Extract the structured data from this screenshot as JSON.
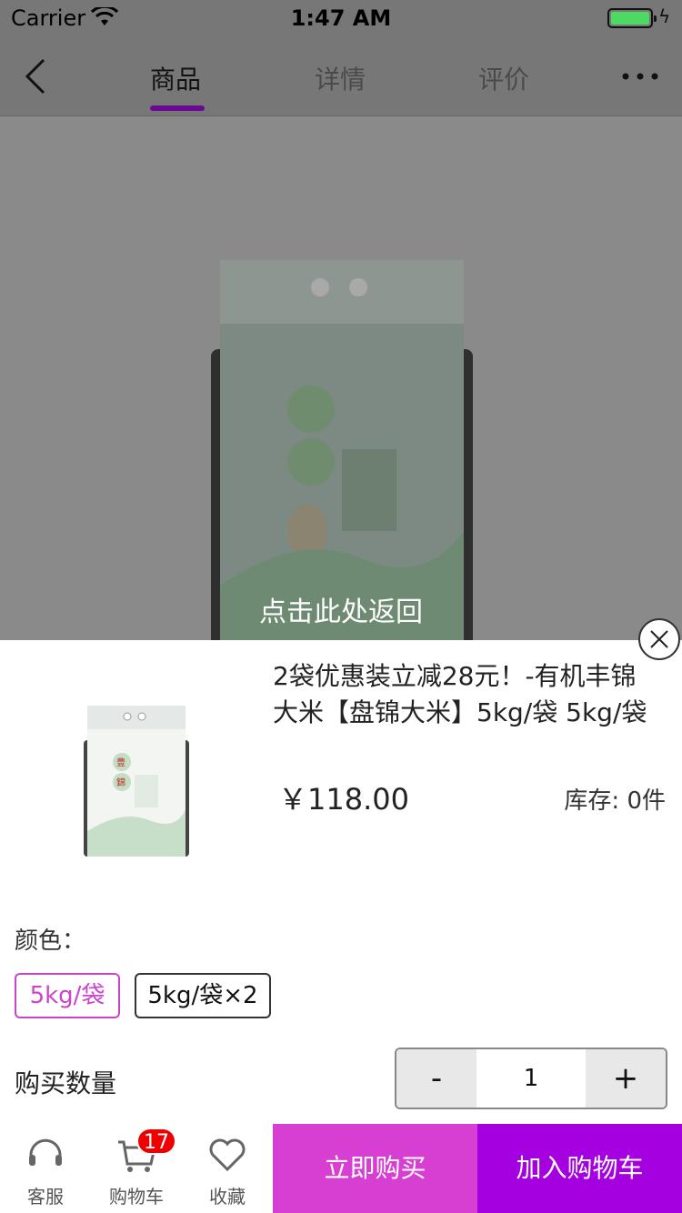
{
  "status_bar": {
    "carrier": "Carrier",
    "time": "1:47 AM"
  },
  "nav": {
    "tabs": [
      {
        "label": "商品",
        "active": true
      },
      {
        "label": "详情",
        "active": false
      },
      {
        "label": "评价",
        "active": false
      }
    ],
    "accent": "#6a0a93"
  },
  "hero": {
    "return_hint": "点击此处返回"
  },
  "sheet": {
    "title": "2袋优惠装立减28元！-有机丰锦大米【盘锦大米】5kg/袋 5kg/袋",
    "price": "￥118.00",
    "stock": "库存: 0件",
    "color_label": "颜色：",
    "options": [
      {
        "label": "5kg/袋",
        "selected": true
      },
      {
        "label": "5kg/袋×2",
        "selected": false
      }
    ],
    "qty_label": "购买数量",
    "qty_minus": "-",
    "qty_value": "1",
    "qty_plus": "+"
  },
  "toolbar": {
    "service_label": "客服",
    "cart_label": "购物车",
    "cart_badge": "17",
    "favorite_label": "收藏",
    "buy_now_label": "立即购买",
    "add_cart_label": "加入购物车",
    "buy_now_color": "#d63fd1",
    "add_cart_color": "#a400e0"
  }
}
